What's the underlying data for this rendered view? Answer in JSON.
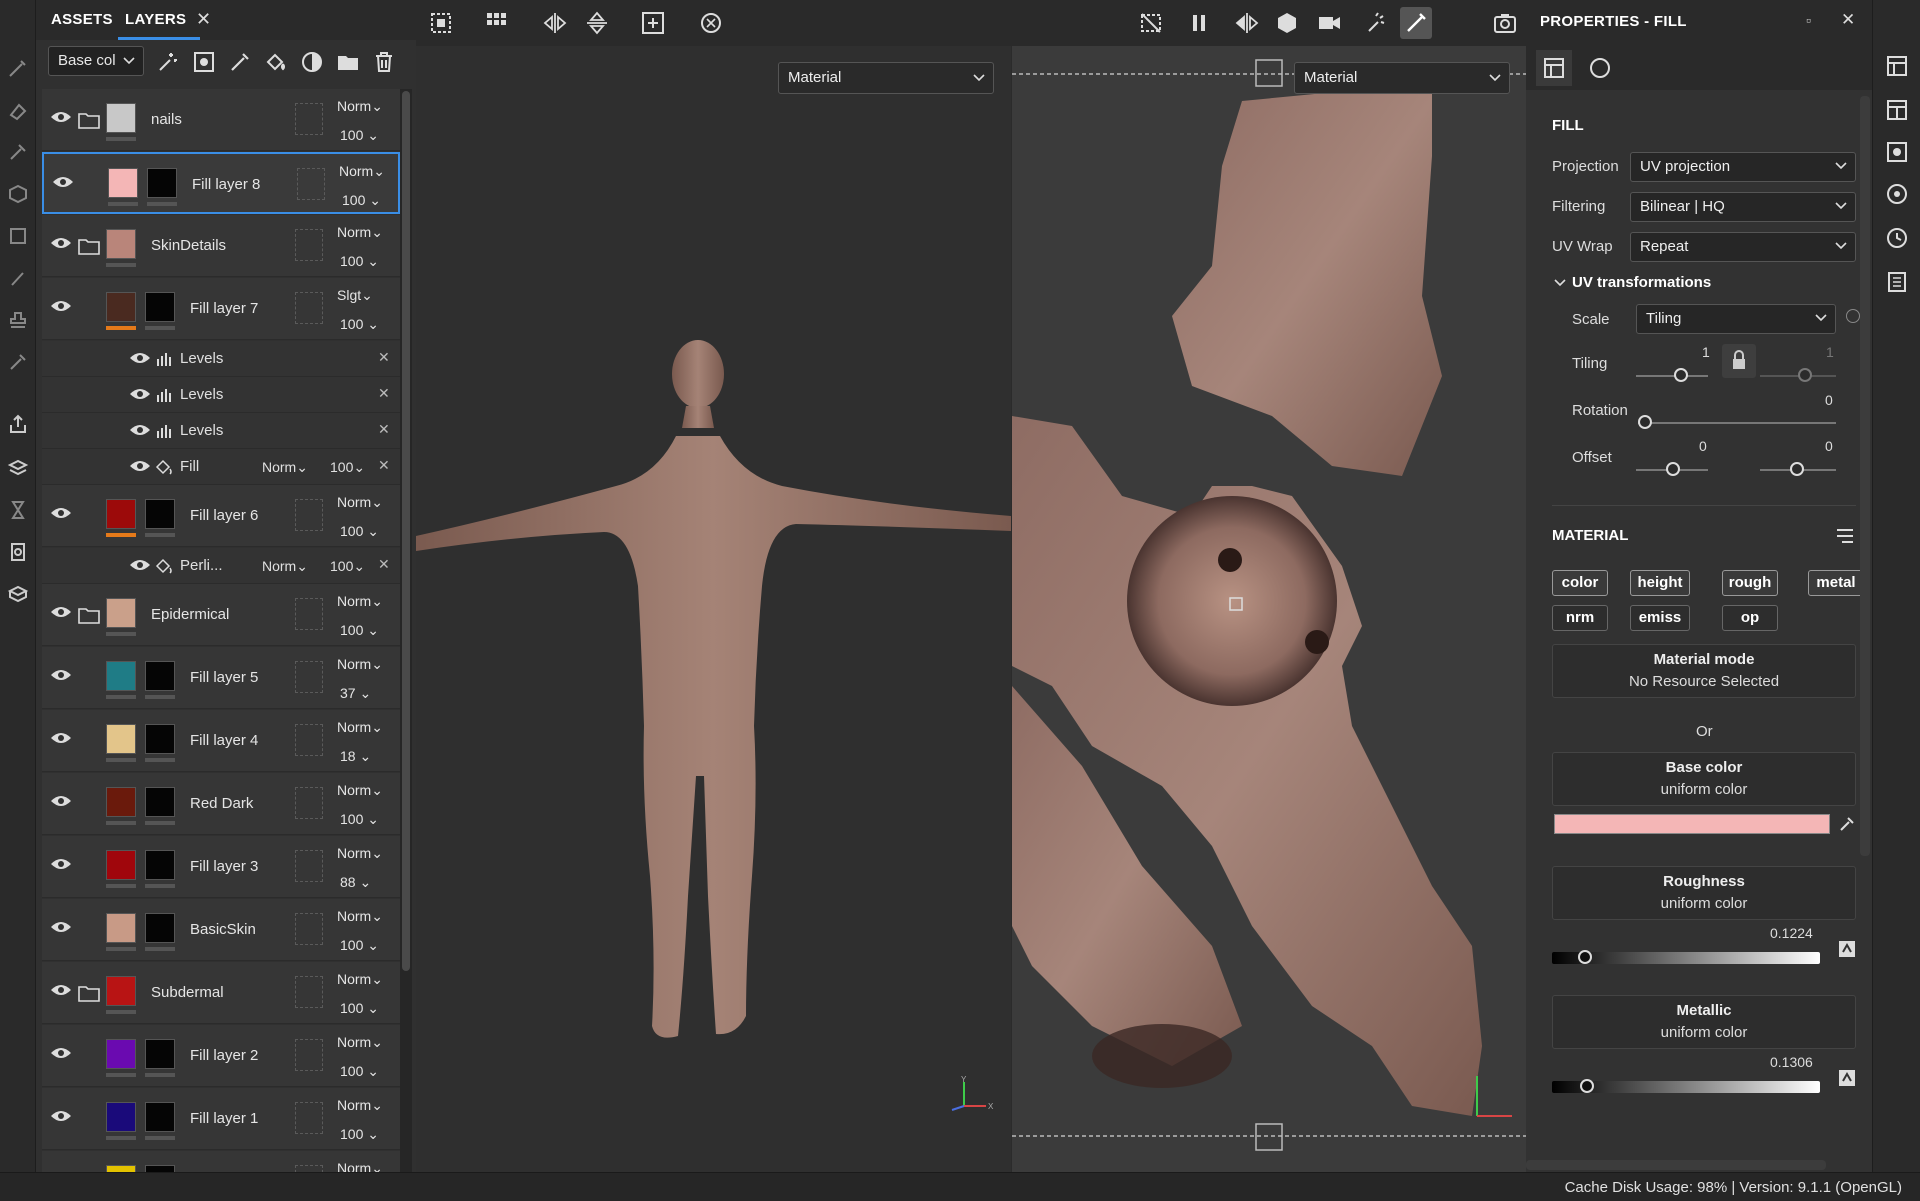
{
  "panel": {
    "tab_assets": "ASSETS",
    "tab_layers": "LAYERS"
  },
  "layers_toolbar": {
    "channel": "Base col"
  },
  "layers": [
    {
      "name": "nails",
      "blend": "Norm",
      "opacity": "100",
      "type": "folder",
      "thumb_color": "#c8c8c8"
    },
    {
      "name": "Fill layer 8",
      "blend": "Norm",
      "opacity": "100",
      "type": "fill",
      "thumb_color": "#f4b6b6",
      "selected": true
    },
    {
      "name": "SkinDetails",
      "blend": "Norm",
      "opacity": "100",
      "type": "folder",
      "thumb_color": "#b9857a"
    },
    {
      "name": "Fill layer 7",
      "blend": "Slgt",
      "opacity": "100",
      "type": "fill",
      "thumb_color": "#4a2a20",
      "effects": [
        {
          "name": "Levels",
          "icon": "levels-icon"
        },
        {
          "name": "Levels",
          "icon": "levels-icon"
        },
        {
          "name": "Levels",
          "icon": "levels-icon"
        },
        {
          "name": "Fill",
          "icon": "fill-icon",
          "blend": "Norm",
          "opacity": "100"
        }
      ]
    },
    {
      "name": "Fill layer 6",
      "blend": "Norm",
      "opacity": "100",
      "type": "fill",
      "thumb_color": "#9c0a0a",
      "effects": [
        {
          "name": "Perli...",
          "icon": "fill-icon",
          "blend": "Norm",
          "opacity": "100"
        }
      ]
    },
    {
      "name": "Epidermical",
      "blend": "Norm",
      "opacity": "100",
      "type": "folder",
      "thumb_color": "#caa08a"
    },
    {
      "name": "Fill layer 5",
      "blend": "Norm",
      "opacity": "37",
      "type": "fill",
      "thumb_color": "#1f7c86"
    },
    {
      "name": "Fill layer 4",
      "blend": "Norm",
      "opacity": "18",
      "type": "fill",
      "thumb_color": "#e3c58a"
    },
    {
      "name": "Red Dark",
      "blend": "Norm",
      "opacity": "100",
      "type": "fill",
      "thumb_color": "#6a1a0c"
    },
    {
      "name": "Fill layer 3",
      "blend": "Norm",
      "opacity": "88",
      "type": "fill",
      "thumb_color": "#a0060c"
    },
    {
      "name": "BasicSkin",
      "blend": "Norm",
      "opacity": "100",
      "type": "fill",
      "thumb_color": "#c89a86"
    },
    {
      "name": "Subdermal",
      "blend": "Norm",
      "opacity": "100",
      "type": "folder",
      "thumb_color": "#b81414"
    },
    {
      "name": "Fill layer 2",
      "blend": "Norm",
      "opacity": "100",
      "type": "fill",
      "thumb_color": "#6a0ab0"
    },
    {
      "name": "Fill layer 1",
      "blend": "Norm",
      "opacity": "100",
      "type": "fill",
      "thumb_color": "#1a0a7a"
    },
    {
      "name": "",
      "blend": "Norm",
      "opacity": "",
      "type": "fill",
      "thumb_color": "#e3c200"
    }
  ],
  "viewport": {
    "mode_3d": "Material",
    "mode_2d": "Material"
  },
  "properties": {
    "title": "PROPERTIES - FILL",
    "fill_section": "FILL",
    "projection_label": "Projection",
    "projection_value": "UV projection",
    "filtering_label": "Filtering",
    "filtering_value": "Bilinear | HQ",
    "uvwrap_label": "UV Wrap",
    "uvwrap_value": "Repeat",
    "uvtrans_label": "UV transformations",
    "scale_label": "Scale",
    "scale_value": "Tiling",
    "tiling_label": "Tiling",
    "tiling_u": "1",
    "tiling_v": "1",
    "rotation_label": "Rotation",
    "rotation_value": "0",
    "offset_label": "Offset",
    "offset_u": "0",
    "offset_v": "0",
    "material_section": "MATERIAL",
    "channels": [
      "color",
      "height",
      "rough",
      "metal",
      "nrm",
      "emiss",
      "op"
    ],
    "material_mode": "Material mode",
    "no_resource": "No Resource Selected",
    "or": "Or",
    "base_color_label": "Base color",
    "base_color_sub": "uniform color",
    "base_color_hex": "#f4b6b6",
    "roughness_label": "Roughness",
    "roughness_sub": "uniform color",
    "roughness_value": "0.1224",
    "roughness_level": 0.1224,
    "metallic_label": "Metallic",
    "metallic_sub": "uniform color",
    "metallic_value": "0.1306",
    "metallic_level": 0.1306
  },
  "status": {
    "text": "Cache Disk Usage:     98% | Version: 9.1.1 (OpenGL)"
  }
}
